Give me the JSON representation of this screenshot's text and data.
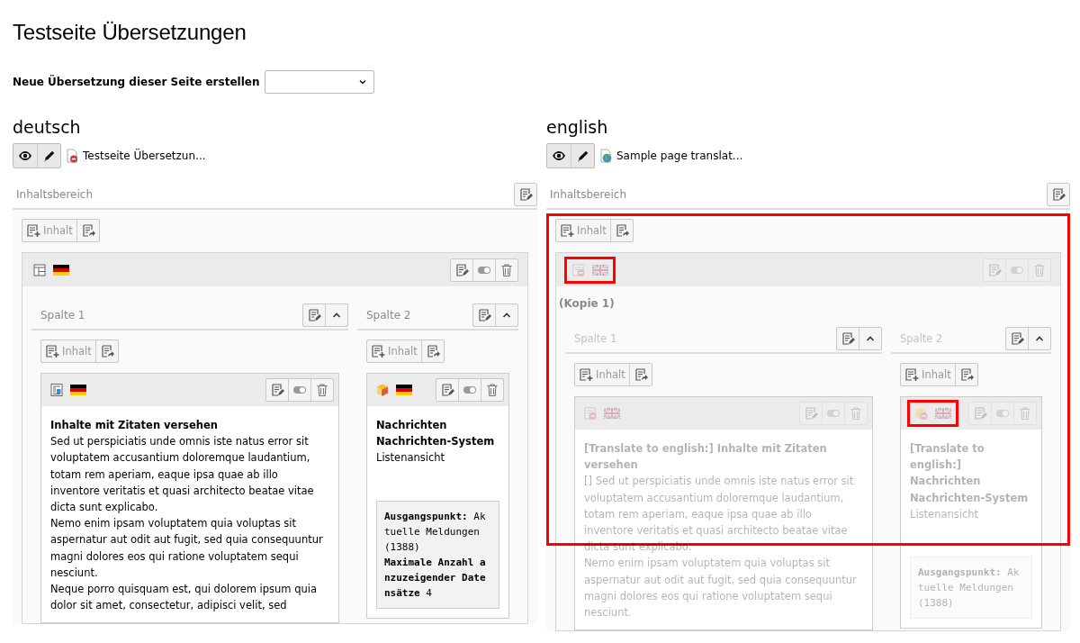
{
  "title": "Testseite Übersetzungen",
  "new_translation": {
    "label": "Neue Übersetzung dieser Seite erstellen"
  },
  "languages": [
    {
      "name": "deutsch",
      "page_title": "Testseite Übersetzun...",
      "page_icon": {
        "kind": "hidden"
      },
      "area_title": "Inhaltsbereich",
      "add_label": "Inhalt",
      "highlighted": false,
      "container": {
        "icon": {
          "kind": "grid"
        },
        "flag": {
          "kind": "de"
        },
        "faded": false,
        "icons_highlighted": false,
        "columns": [
          {
            "title": "Spalte 1",
            "add_label": "Inhalt",
            "elements": [
              {
                "icon": {
                  "kind": "textpic"
                },
                "flag": {
                  "kind": "de"
                },
                "faded": false,
                "icons_highlighted": false,
                "heading": "Inhalte mit Zitaten versehen",
                "paragraphs": [
                  "Sed ut perspiciatis unde omnis iste natus error sit voluptatem accusantium doloremque laudantium, totam rem aperiam, eaque ipsa quae ab illo inventore veritatis et quasi architecto beatae vitae dicta sunt explicabo.",
                  "Nemo enim ipsam voluptatem quia voluptas sit aspernatur aut odit aut fugit, sed quia consequuntur magni dolores eos qui ratione voluptatem sequi nesciunt.",
                  "Neque porro quisquam est, qui dolorem ipsum quia dolor sit amet, consectetur, adipisci velit, sed"
                ]
              }
            ]
          },
          {
            "title": "Spalte 2",
            "add_label": "Inhalt",
            "elements": [
              {
                "icon": {
                  "kind": "plugin"
                },
                "flag": {
                  "kind": "de"
                },
                "faded": false,
                "icons_highlighted": false,
                "heading": "Nachrichten Nachrichten-System",
                "subtitle": "Listenansicht",
                "info": [
                  "**Ausgangspunkt:** Aktuelle Meldungen (1388)",
                  "**Maximale Anzahl anzuzeigender Datensätze** 4"
                ]
              }
            ]
          }
        ]
      }
    },
    {
      "name": "english",
      "page_title": "Sample page translat...",
      "page_icon": {
        "kind": "globe"
      },
      "area_title": "Inhaltsbereich",
      "add_label": "Inhalt",
      "highlighted": true,
      "container": {
        "icon": {
          "kind": "hidden"
        },
        "flag": {
          "kind": "gb"
        },
        "faded": true,
        "icons_highlighted": true,
        "note": "(Kopie 1)",
        "columns": [
          {
            "title": "Spalte 1",
            "add_label": "Inhalt",
            "elements": [
              {
                "icon": {
                  "kind": "hidden"
                },
                "flag": {
                  "kind": "gb"
                },
                "faded": true,
                "icons_highlighted": false,
                "heading": "[Translate to english:] Inhalte mit Zitaten versehen",
                "paragraphs": [
                  "[] Sed ut perspiciatis unde omnis iste natus error sit voluptatem accusantium doloremque laudantium, totam rem aperiam, eaque ipsa quae ab illo inventore veritatis et quasi architecto beatae vitae dicta sunt explicabo.",
                  "Nemo enim ipsam voluptatem quia voluptas sit aspernatur aut odit aut fugit, sed quia consequuntur magni dolores eos qui ratione voluptatem sequi nesciunt."
                ]
              }
            ]
          },
          {
            "title": "Spalte 2",
            "add_label": "Inhalt",
            "elements": [
              {
                "icon": {
                  "kind": "plugin-hidden"
                },
                "flag": {
                  "kind": "gb"
                },
                "faded": true,
                "icons_highlighted": true,
                "heading": "[Translate to english:] Nachrichten Nachrichten-System",
                "subtitle": "Listenansicht",
                "info": [
                  "**Ausgangspunkt:** Aktuelle Meldungen (1388)"
                ]
              }
            ]
          }
        ]
      }
    }
  ]
}
